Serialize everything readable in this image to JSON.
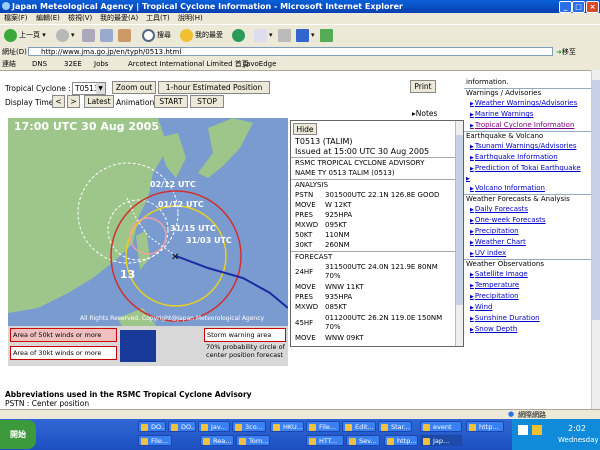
{
  "window": {
    "title": "Japan Meteological Agency | Tropical Cyclone Information - Microsoft Internet Explorer"
  },
  "menubar": [
    "檔案(F)",
    "編輯(E)",
    "檢視(V)",
    "我的最愛(A)",
    "工具(T)",
    "說明(H)"
  ],
  "toolbar": {
    "back": "上一頁",
    "search": "搜尋",
    "favorites": "我的最愛"
  },
  "address": {
    "label": "網址(D)",
    "url": "http://www.jma.go.jp/en/typh/0513.html",
    "go": "移至"
  },
  "links": {
    "label": "連結",
    "items": [
      "DNS",
      "32EE",
      "Jobs",
      "Arcotect International Limited 首頁",
      "JavoEdge"
    ]
  },
  "controls": {
    "cyclone_label": "Tropical Cyclone :",
    "cyclone_value": "T0513",
    "zoom_out": "Zoom out",
    "estimated_position": "1-hour Estimated Position",
    "print": "Print",
    "display_time": "Display Time",
    "prev": "<",
    "next": ">",
    "latest": "Latest",
    "animation": "Animation",
    "start": "START",
    "stop": "STOP",
    "notes": "Notes"
  },
  "map": {
    "timestamp": "17:00 UTC  30 Aug 2005",
    "labels": [
      "02/12 UTC",
      "01/12 UTC",
      "31/15 UTC",
      "31/03 UTC"
    ],
    "number": "13",
    "copyright": "All Rights Reserved, Copyright@Japan Meteorological Agency",
    "legend": {
      "area50": "Area of 50kt winds or more",
      "area30": "Area of 30kt winds or more",
      "storm_warning": "Storm warning area",
      "prob_circle": "70% probability circle of center position forecast"
    }
  },
  "advisory": {
    "hide": "Hide",
    "id": "T0513 (TALIM)",
    "issued": "Issued at 15:00 UTC 30 Aug 2005",
    "header1": "RSMC TROPICAL CYCLONE ADVISORY",
    "header2": "NAME  TY 0513 TALIM (0513)",
    "analysis_title": "ANALYSIS",
    "analysis": [
      [
        "PSTN",
        "301500UTC 22.1N 126.8E GOOD"
      ],
      [
        "MOVE",
        "W 12KT"
      ],
      [
        "PRES",
        "925HPA"
      ],
      [
        "MXWD",
        "095KT"
      ],
      [
        "50KT",
        "110NM"
      ],
      [
        "30KT",
        "260NM"
      ]
    ],
    "forecast_title": "FORECAST",
    "forecast24": [
      "24HF",
      "311500UTC 24.0N 121.9E 80NM 70%"
    ],
    "forecast24b": [
      [
        "MOVE",
        "WNW 11KT"
      ],
      [
        "PRES",
        "935HPA"
      ],
      [
        "MXWD",
        "085KT"
      ]
    ],
    "forecast45": [
      "45HF",
      "011200UTC 26.2N 119.0E 150NM 70%"
    ],
    "forecast45b": [
      [
        "MOVE",
        "WNW 09KT"
      ]
    ]
  },
  "sidebar": {
    "top_text": "information.",
    "sections": [
      {
        "title": "Warnings / Advisories",
        "links": [
          "Weather Warnings/Advisories",
          "Marine Warnings",
          "Tropical Cyclone Information"
        ]
      },
      {
        "title": "Earthquake & Volcano",
        "links": [
          "Tsunami Warnings/Advisories",
          "Earthquake Information",
          "Prediction of Tokai Earthquake",
          "Volcano Information"
        ]
      },
      {
        "title": "Weather Forecasts & Analysis",
        "links": [
          "Daily Forecasts",
          "One-week Forecasts",
          "Precipitation",
          "Weather Chart",
          "UV index"
        ]
      },
      {
        "title": "Weather Observations",
        "links": [
          "Satellite Image",
          "Temperature",
          "Precipitation",
          "Wind",
          "Sunshine Duration",
          "Snow Depth"
        ]
      }
    ]
  },
  "abbrev": {
    "title": "Abbreviations used in the RSMC Tropical Cyclone Advisory",
    "line1": "PSTN : Center position"
  },
  "status": {
    "zone": "網際網路"
  },
  "taskbar": {
    "start": "開始",
    "row1": [
      "DO...",
      "DO...",
      "Jav...",
      "3co...",
      "HKU...",
      "File...",
      "Edit...",
      "Star...",
      "event",
      "http..."
    ],
    "row2": [
      "File...",
      "Rea...",
      "Tom...",
      "HTT...",
      "Sev...",
      "http...",
      "Jap..."
    ],
    "clock": "2:02",
    "day": "Wednesday"
  },
  "colors": {
    "titlebar": "#0a5fd8",
    "taskbar": "#1d4fc0",
    "link": "#0000cc"
  }
}
